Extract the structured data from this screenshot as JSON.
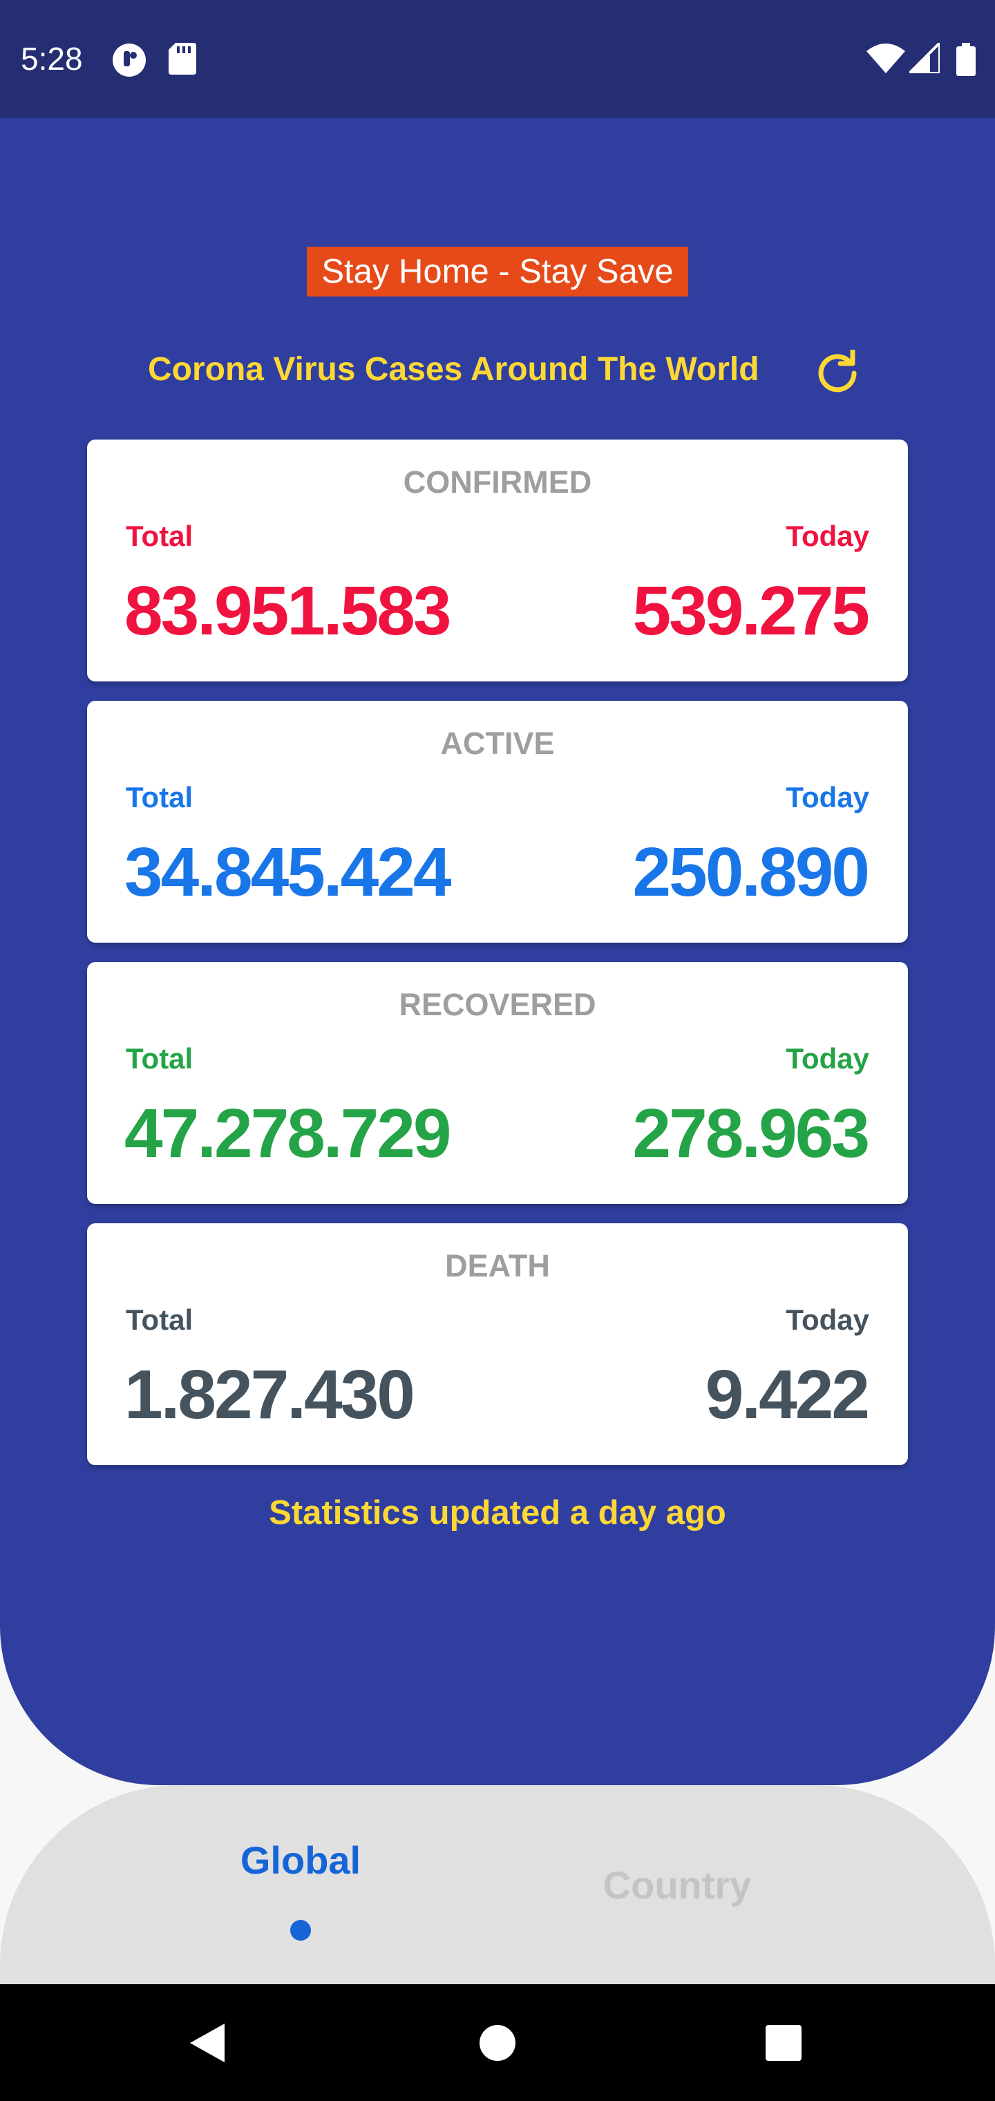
{
  "status_bar": {
    "time": "5:28",
    "left_icons": [
      "pocket-app-icon",
      "sd-card-icon"
    ],
    "right_icons": [
      "wifi-icon",
      "cell-signal-icon",
      "battery-icon"
    ]
  },
  "banner": {
    "text": "Stay Home - Stay Save"
  },
  "header": {
    "title": "Corona Virus Cases Around The World",
    "refresh_icon": "refresh-icon"
  },
  "stats": [
    {
      "title": "CONFIRMED",
      "total_label": "Total",
      "today_label": "Today",
      "total": "83.951.583",
      "today": "539.275",
      "color": "#f0123f"
    },
    {
      "title": "ACTIVE",
      "total_label": "Total",
      "today_label": "Today",
      "total": "34.845.424",
      "today": "250.890",
      "color": "#1976e8"
    },
    {
      "title": "RECOVERED",
      "total_label": "Total",
      "today_label": "Today",
      "total": "47.278.729",
      "today": "278.963",
      "color": "#24a347"
    },
    {
      "title": "DEATH",
      "total_label": "Total",
      "today_label": "Today",
      "total": "1.827.430",
      "today": "9.422",
      "color": "#45535e"
    }
  ],
  "updated_text": "Statistics updated a day ago",
  "bottom_nav": {
    "tabs": [
      {
        "label": "Global",
        "active": true
      },
      {
        "label": "Country",
        "active": false
      }
    ]
  },
  "system_nav": [
    "back-icon",
    "home-icon",
    "recents-icon"
  ],
  "colors": {
    "status_bar": "#252e72",
    "hero_background": "#303f9f",
    "banner_background": "#e64a19",
    "accent_yellow": "#fdd835",
    "nav_background": "#e0e0e0",
    "active_tab": "#1565d8",
    "inactive_tab": "#c4c4c4"
  }
}
